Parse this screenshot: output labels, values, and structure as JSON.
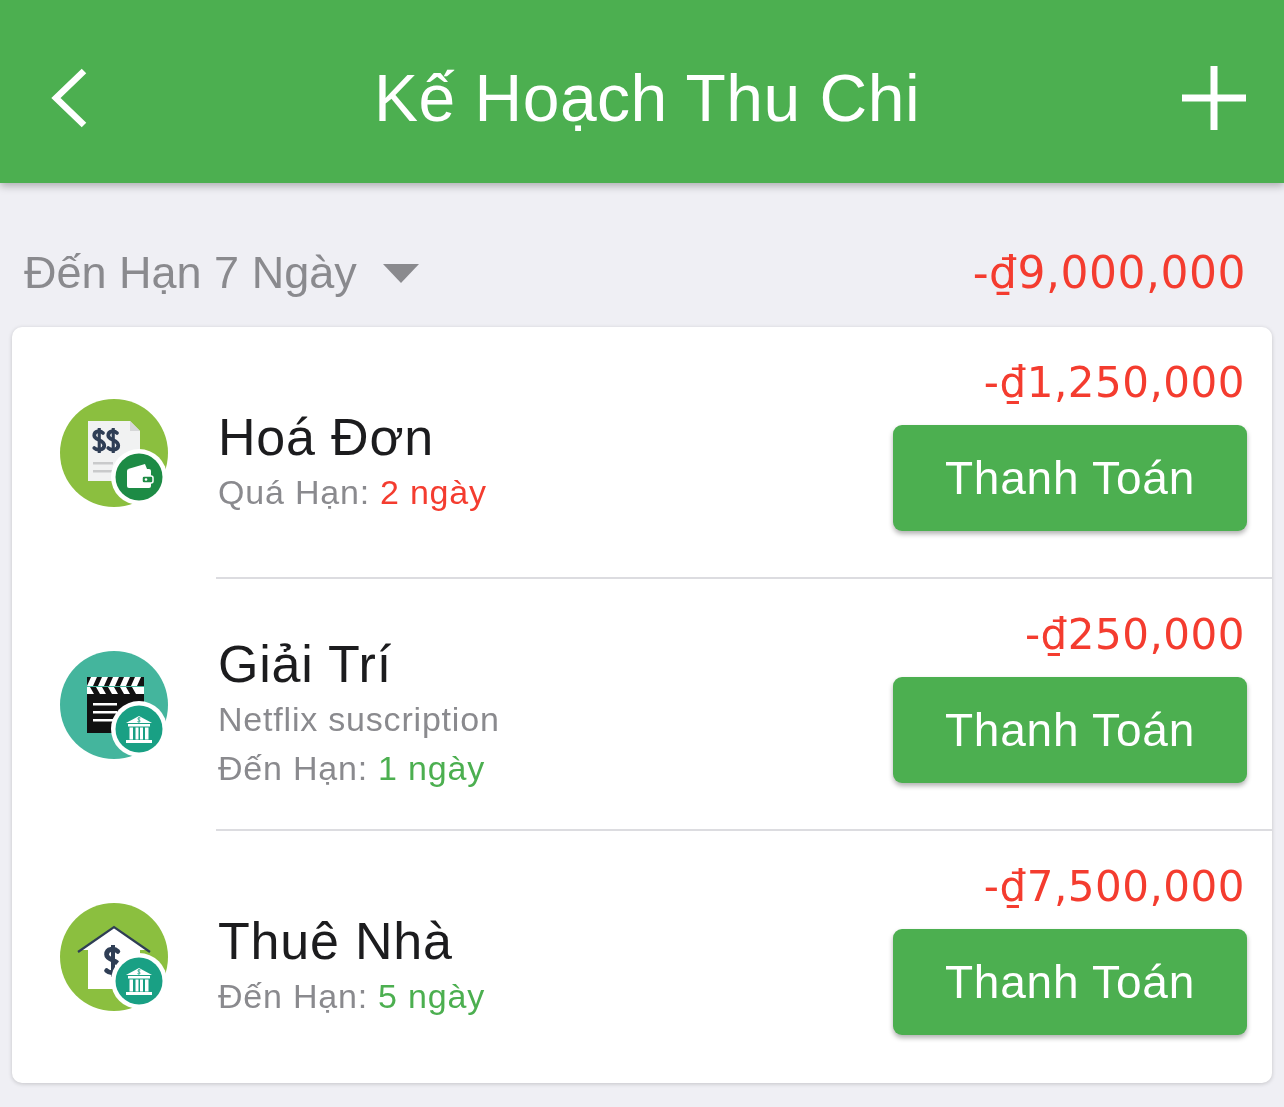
{
  "header": {
    "title": "Kế Hoạch Thu Chi"
  },
  "section": {
    "label": "Đến Hạn 7 Ngày",
    "total": "-₫9,000,000"
  },
  "bills": [
    {
      "title": "Hoá Đơn",
      "due_label": "Quá Hạn:",
      "due_days": "2 ngày",
      "overdue": true,
      "amount": "-₫1,250,000",
      "button": "Thanh Toán"
    },
    {
      "title": "Giải Trí",
      "note": "Netflix suscription",
      "due_label": "Đến Hạn:",
      "due_days": "1 ngày",
      "overdue": false,
      "amount": "-₫250,000",
      "button": "Thanh Toán"
    },
    {
      "title": "Thuê Nhà",
      "due_label": "Đến Hạn:",
      "due_days": "5 ngày",
      "overdue": false,
      "amount": "-₫7,500,000",
      "button": "Thanh Toán"
    }
  ]
}
